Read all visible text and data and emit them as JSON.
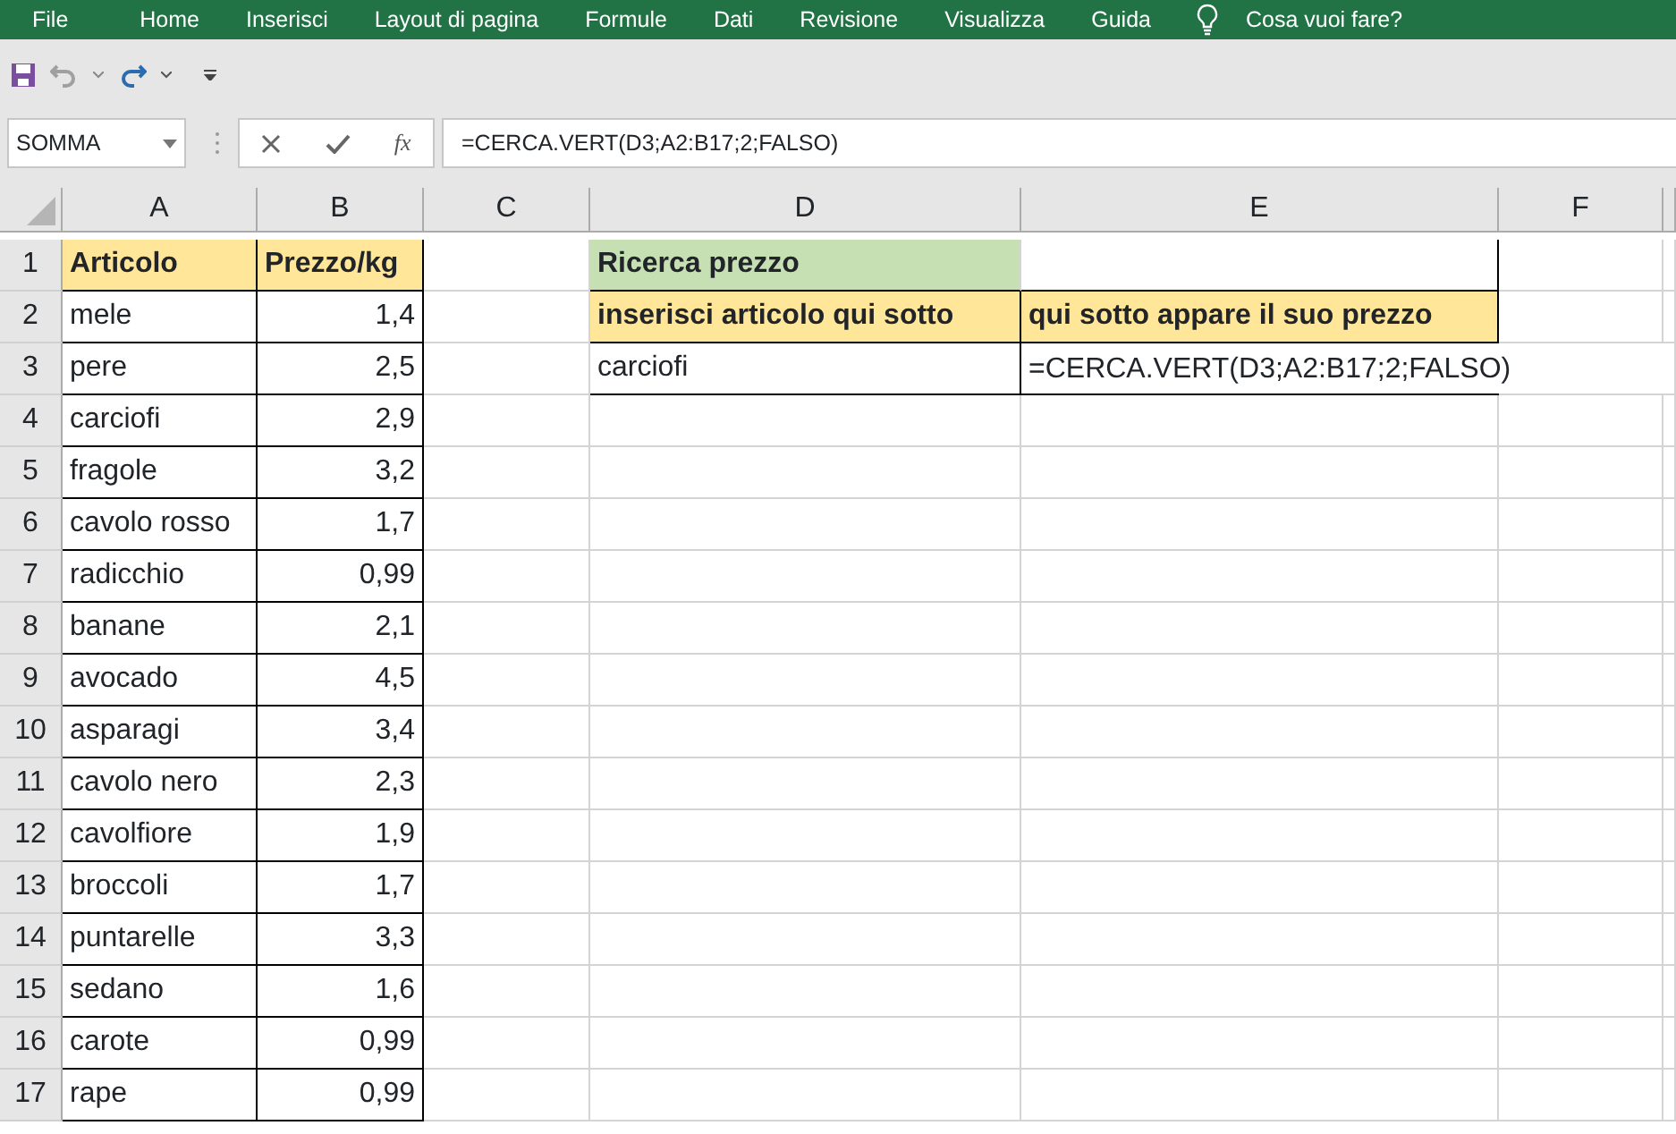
{
  "ribbon_tabs": [
    {
      "label": "File"
    },
    {
      "label": "Home"
    },
    {
      "label": "Inserisci"
    },
    {
      "label": "Layout di pagina"
    },
    {
      "label": "Formule"
    },
    {
      "label": "Dati"
    },
    {
      "label": "Revisione"
    },
    {
      "label": "Visualizza"
    },
    {
      "label": "Guida"
    }
  ],
  "tell_me": {
    "placeholder": "Cosa vuoi fare?"
  },
  "quick_access": {
    "undo_disabled": true
  },
  "name_box": "SOMMA",
  "formula_bar": {
    "function_label": "fx",
    "value": "=CERCA.VERT(D3;A2:B17;2;FALSO)"
  },
  "columns": [
    "A",
    "B",
    "C",
    "D",
    "E",
    "F"
  ],
  "rows": [
    {
      "number": "1",
      "cells": [
        {
          "kind": "header",
          "text": "Articolo"
        },
        {
          "kind": "header",
          "text": "Prezzo/kg"
        },
        {
          "kind": "empty"
        },
        {
          "kind": "title",
          "text": "Ricerca prezzo"
        },
        {
          "kind": "boxed"
        },
        {
          "kind": "empty"
        }
      ]
    },
    {
      "number": "2",
      "cells": [
        {
          "kind": "text",
          "text": "mele"
        },
        {
          "kind": "number",
          "text": "1,4"
        },
        {
          "kind": "empty"
        },
        {
          "kind": "header",
          "text": "inserisci articolo qui sotto"
        },
        {
          "kind": "header",
          "text": "qui sotto appare il suo prezzo"
        },
        {
          "kind": "empty"
        }
      ]
    },
    {
      "number": "3",
      "cells": [
        {
          "kind": "text",
          "text": "pere"
        },
        {
          "kind": "number",
          "text": "2,5"
        },
        {
          "kind": "empty"
        },
        {
          "kind": "text",
          "text": "carciofi"
        },
        {
          "kind": "overflow",
          "text": "=CERCA.VERT(D3;A2:B17;2;FALSO)"
        }
      ]
    },
    {
      "number": "4",
      "cells": [
        {
          "kind": "text",
          "text": "carciofi"
        },
        {
          "kind": "number",
          "text": "2,9"
        }
      ]
    },
    {
      "number": "5",
      "cells": [
        {
          "kind": "text",
          "text": "fragole"
        },
        {
          "kind": "number",
          "text": "3,2"
        }
      ]
    },
    {
      "number": "6",
      "cells": [
        {
          "kind": "text",
          "text": "cavolo rosso"
        },
        {
          "kind": "number",
          "text": "1,7"
        }
      ]
    },
    {
      "number": "7",
      "cells": [
        {
          "kind": "text",
          "text": "radicchio"
        },
        {
          "kind": "number",
          "text": "0,99"
        }
      ]
    },
    {
      "number": "8",
      "cells": [
        {
          "kind": "text",
          "text": "banane"
        },
        {
          "kind": "number",
          "text": "2,1"
        }
      ]
    },
    {
      "number": "9",
      "cells": [
        {
          "kind": "text",
          "text": "avocado"
        },
        {
          "kind": "number",
          "text": "4,5"
        }
      ]
    },
    {
      "number": "10",
      "cells": [
        {
          "kind": "text",
          "text": "asparagi"
        },
        {
          "kind": "number",
          "text": "3,4"
        }
      ]
    },
    {
      "number": "11",
      "cells": [
        {
          "kind": "text",
          "text": "cavolo nero"
        },
        {
          "kind": "number",
          "text": "2,3"
        }
      ]
    },
    {
      "number": "12",
      "cells": [
        {
          "kind": "text",
          "text": "cavolfiore"
        },
        {
          "kind": "number",
          "text": "1,9"
        }
      ]
    },
    {
      "number": "13",
      "cells": [
        {
          "kind": "text",
          "text": "broccoli"
        },
        {
          "kind": "number",
          "text": "1,7"
        }
      ]
    },
    {
      "number": "14",
      "cells": [
        {
          "kind": "text",
          "text": "puntarelle"
        },
        {
          "kind": "number",
          "text": "3,3"
        }
      ]
    },
    {
      "number": "15",
      "cells": [
        {
          "kind": "text",
          "text": "sedano"
        },
        {
          "kind": "number",
          "text": "1,6"
        }
      ]
    },
    {
      "number": "16",
      "cells": [
        {
          "kind": "text",
          "text": "carote"
        },
        {
          "kind": "number",
          "text": "0,99"
        }
      ]
    },
    {
      "number": "17",
      "cells": [
        {
          "kind": "text",
          "text": "rape"
        },
        {
          "kind": "number",
          "text": "0,99"
        }
      ]
    }
  ]
}
